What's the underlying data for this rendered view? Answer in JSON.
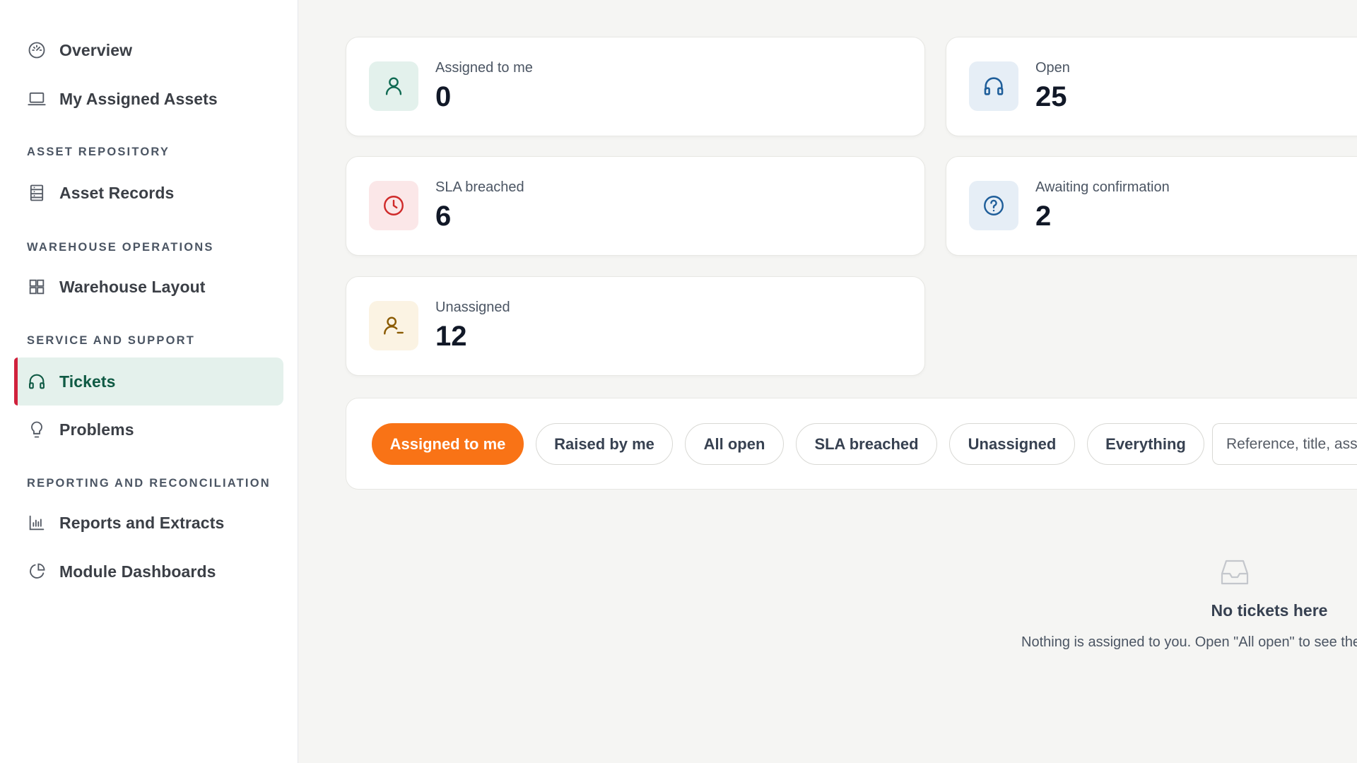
{
  "sidebar": {
    "items": [
      {
        "label": "Overview",
        "icon": "gauge-icon"
      },
      {
        "label": "My Assigned Assets",
        "icon": "laptop-icon"
      },
      {
        "label": "Asset Records",
        "icon": "records-icon"
      },
      {
        "label": "Warehouse Layout",
        "icon": "grid-icon"
      },
      {
        "label": "Tickets",
        "icon": "headset-icon",
        "active": true
      },
      {
        "label": "Problems",
        "icon": "lightbulb-icon"
      },
      {
        "label": "Reports and Extracts",
        "icon": "bar-chart-icon"
      },
      {
        "label": "Module Dashboards",
        "icon": "pie-chart-icon"
      }
    ],
    "sections": [
      "ASSET REPOSITORY",
      "WAREHOUSE OPERATIONS",
      "SERVICE AND SUPPORT",
      "REPORTING AND RECONCILIATION"
    ]
  },
  "stats": {
    "assigned": {
      "label": "Assigned to me",
      "value": "0",
      "icon": "user-icon"
    },
    "open": {
      "label": "Open",
      "value": "25",
      "icon": "headset-icon"
    },
    "sla": {
      "label": "SLA breached",
      "value": "6",
      "icon": "clock-icon"
    },
    "awaiting": {
      "label": "Awaiting confirmation",
      "value": "2",
      "icon": "question-icon"
    },
    "unassigned": {
      "label": "Unassigned",
      "value": "12",
      "icon": "user-minus-icon"
    }
  },
  "filters": {
    "chips": [
      {
        "label": "Assigned to me",
        "active": true
      },
      {
        "label": "Raised by me"
      },
      {
        "label": "All open"
      },
      {
        "label": "SLA breached"
      },
      {
        "label": "Unassigned"
      },
      {
        "label": "Everything"
      }
    ],
    "search_placeholder": "Reference, title, ass"
  },
  "empty_state": {
    "icon": "inbox-icon",
    "title": "No tickets here",
    "description": "Nothing is assigned to you. Open \"All open\" to see the"
  },
  "colors": {
    "accent_orange": "#f97316",
    "active_nav_bg": "#e4f1ec",
    "active_nav_text": "#0f5a44",
    "active_nav_marker": "#d0213c"
  }
}
